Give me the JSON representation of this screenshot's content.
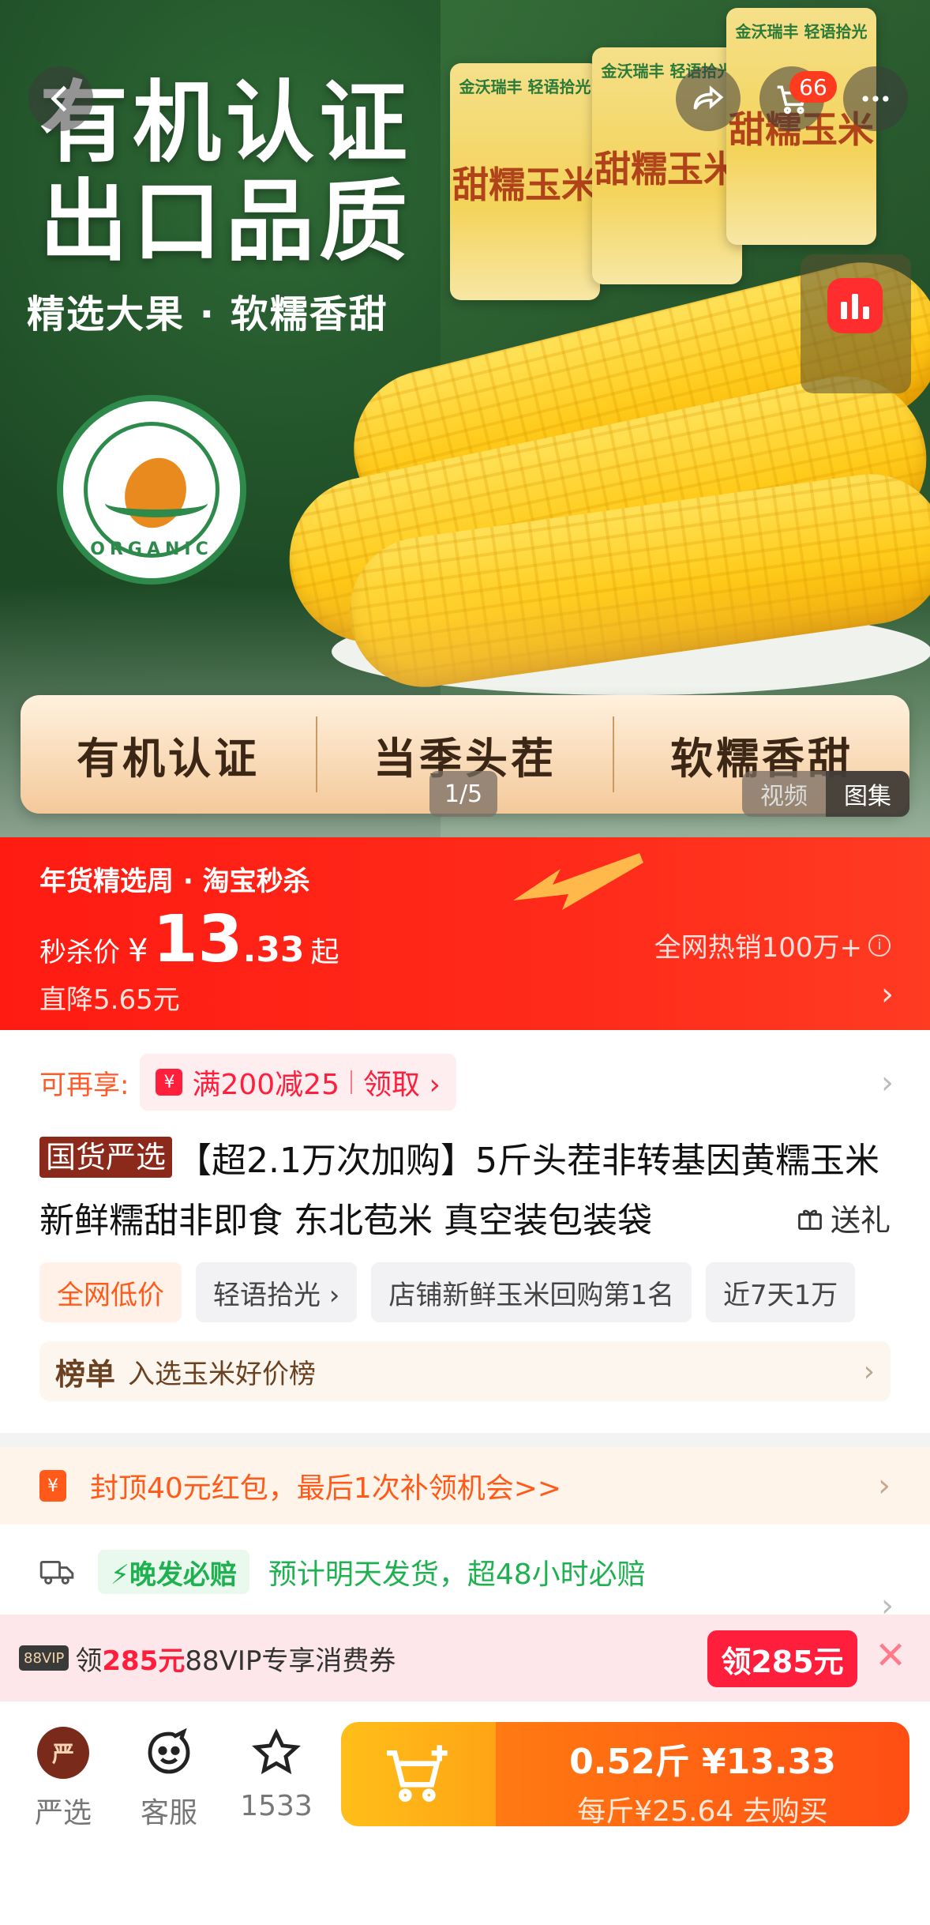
{
  "hero": {
    "headline_1": "有机认证",
    "headline_2": "出口品质",
    "subline": "精选大果 · 软糯香甜",
    "seal_text": "ORGANIC",
    "package_brand": "金沃瑞丰 轻语拾光",
    "package_name": "甜糯玉米",
    "features": [
      "有机认证",
      "当季头茬",
      "软糯香甜"
    ],
    "counter": "1/5",
    "media_tabs": [
      "视频",
      "图集"
    ],
    "active_media_tab": "图集",
    "cart_count": "66",
    "icons": {
      "back": "back-arrow-icon",
      "share": "share-icon",
      "cart": "cart-icon",
      "more": "more-icon",
      "live": "live-icon"
    }
  },
  "promo": {
    "title": "年货精选周 · 淘宝秒杀",
    "price_label": "秒杀价",
    "currency": "¥",
    "price_int": "13",
    "price_dec": ".33",
    "price_suffix": "起",
    "hot_sales": "全网热销100万+",
    "drop": "直降5.65元",
    "accent_color": "#ff1b12"
  },
  "coupon": {
    "label": "可再享:",
    "icon_text": "¥",
    "offer": "满200减25",
    "action": "领取 ›"
  },
  "product": {
    "tag": "国货严选",
    "title": "【超2.1万次加购】5斤头茬非转基因黄糯玉米新鲜糯甜非即食 东北苞米 真空装包装袋",
    "gift_label": "送礼",
    "tags": [
      "全网低价",
      "轻语拾光 ›",
      "店铺新鲜玉米回购第1名",
      "近7天1万"
    ],
    "rank_badge": "榜单",
    "rank_text": "入选玉米好价榜"
  },
  "red_packet": {
    "icon_text": "¥",
    "text": "封顶40元红包，最后1次补领机会>>"
  },
  "delivery": {
    "badge": "⚡晚发必赔",
    "estimate": "预计明天发货，超48小时必赔"
  },
  "vip": {
    "logo": "88VIP",
    "prefix": "领",
    "amount": "285元",
    "suffix": "88VIP专享消费券",
    "button": "领285元",
    "close": "✕"
  },
  "bottom_bar": {
    "store_logo": "严",
    "store_label": "严选",
    "service_label": "客服",
    "fav_count": "1533",
    "buy_line1": "0.52斤 ¥13.33",
    "buy_line2": "每斤¥25.64  去购买"
  }
}
